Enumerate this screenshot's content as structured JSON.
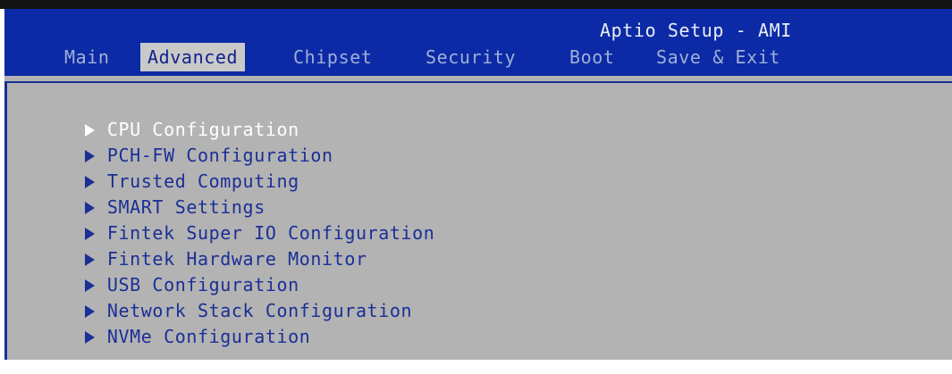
{
  "header": {
    "title": "Aptio Setup - AMI",
    "tabs": [
      {
        "label": "Main",
        "active": false
      },
      {
        "label": "Advanced",
        "active": true
      },
      {
        "label": "Chipset",
        "active": false
      },
      {
        "label": "Security",
        "active": false
      },
      {
        "label": "Boot",
        "active": false
      },
      {
        "label": "Save & Exit",
        "active": false
      }
    ]
  },
  "menu": {
    "items": [
      {
        "label": "CPU Configuration",
        "icon": "submenu-arrow-icon",
        "selected": true
      },
      {
        "label": "PCH-FW Configuration",
        "icon": "submenu-arrow-icon"
      },
      {
        "label": "Trusted Computing",
        "icon": "submenu-arrow-icon"
      },
      {
        "label": "SMART Settings",
        "icon": "submenu-arrow-icon"
      },
      {
        "label": "Fintek Super IO Configuration",
        "icon": "submenu-arrow-icon"
      },
      {
        "label": "Fintek Hardware Monitor",
        "icon": "submenu-arrow-icon"
      },
      {
        "label": "USB Configuration",
        "icon": "submenu-arrow-icon"
      },
      {
        "label": "Network Stack Configuration",
        "icon": "submenu-arrow-icon"
      },
      {
        "label": "NVMe Configuration",
        "icon": "submenu-arrow-icon"
      }
    ]
  },
  "colors": {
    "header_bg": "#0c2aa6",
    "panel_bg": "#b3b3b3",
    "item_text": "#1b2f96",
    "selected_text": "#ffffff",
    "active_tab_bg": "#c9c9c9"
  }
}
